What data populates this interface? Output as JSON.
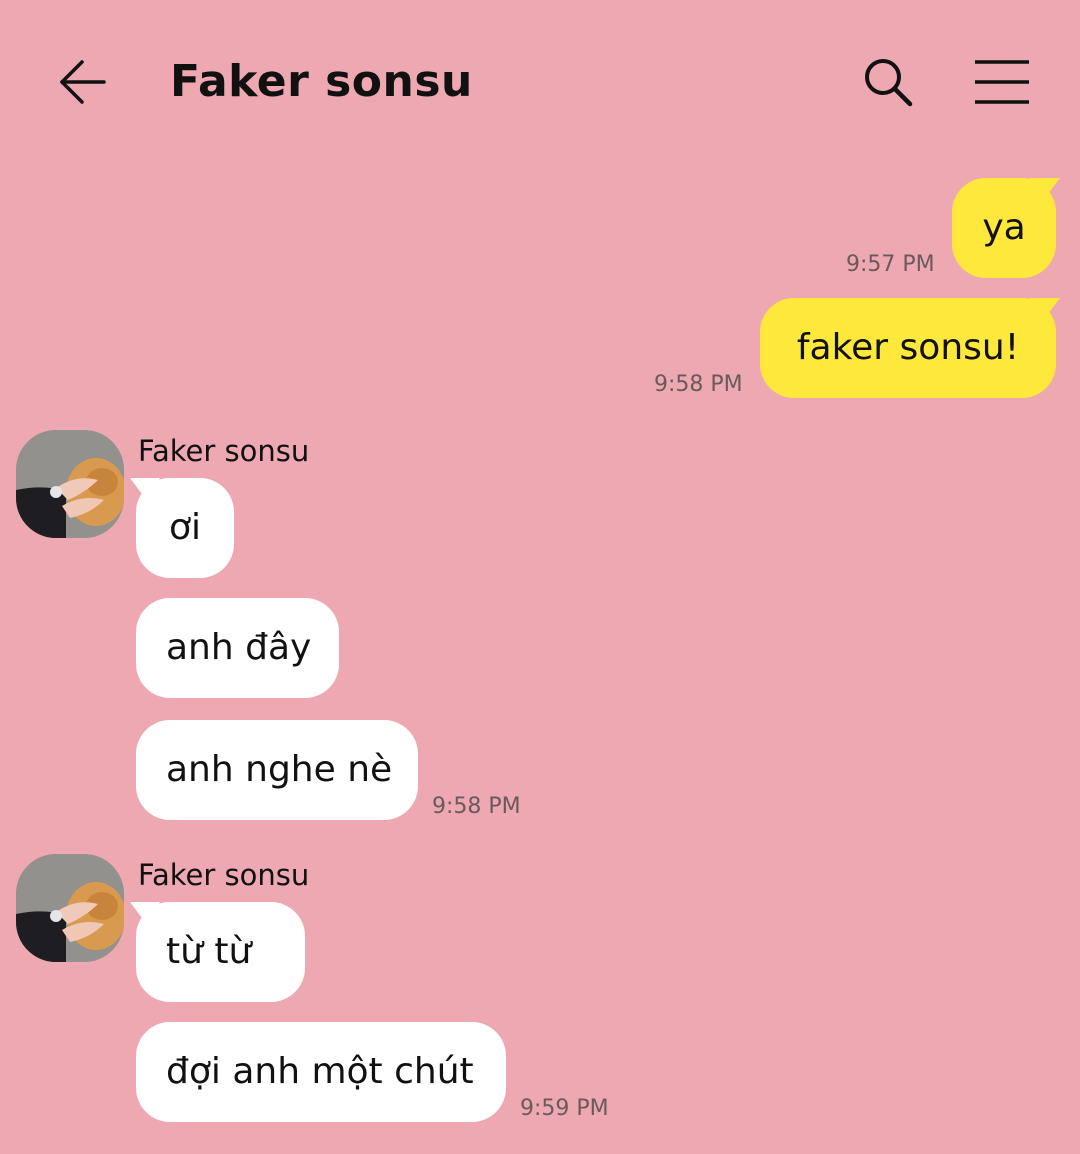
{
  "header": {
    "title": "Faker sonsu",
    "back_icon": "arrow-left-icon",
    "search_icon": "search-icon",
    "menu_icon": "hamburger-menu-icon"
  },
  "colors": {
    "background": "#eda8b1",
    "outgoing_bubble": "#ffe83c",
    "incoming_bubble": "#ffffff",
    "timestamp": "#6b5a5d"
  },
  "outgoing": [
    {
      "text": "ya",
      "time": "9:57 PM"
    },
    {
      "text": "faker sonsu!",
      "time": "9:58 PM"
    }
  ],
  "incoming_groups": [
    {
      "sender": "Faker sonsu",
      "messages": [
        "ơi",
        "anh đây",
        "anh nghe nè"
      ],
      "time": "9:58 PM"
    },
    {
      "sender": "Faker sonsu",
      "messages": [
        "từ từ",
        "đợi anh một chút"
      ],
      "time": "9:59 PM"
    }
  ]
}
